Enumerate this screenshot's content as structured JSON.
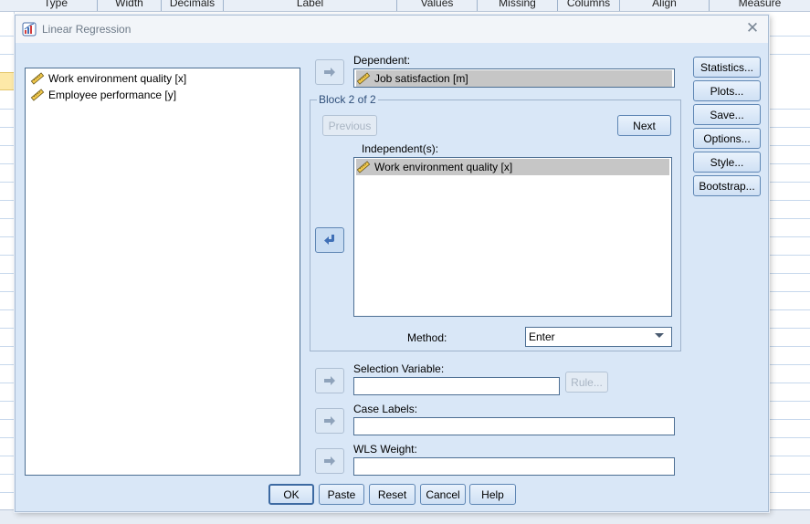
{
  "background": {
    "columns": [
      "Type",
      "Width",
      "Decimals",
      "Label",
      "Values",
      "Missing",
      "Columns",
      "Align",
      "Measure"
    ]
  },
  "dialog": {
    "title": "Linear Regression",
    "source_list": [
      {
        "label": "Work environment quality [x]",
        "icon": "scale-ruler-icon"
      },
      {
        "label": "Employee performance [y]",
        "icon": "scale-ruler-icon"
      }
    ],
    "dependent": {
      "label": "Dependent:",
      "value": "Job satisfaction [m]"
    },
    "block": {
      "title": "Block 2 of 2",
      "previous_label": "Previous",
      "next_label": "Next",
      "independents_label": "Independent(s):",
      "independents": [
        "Work environment quality [x]"
      ],
      "method_label": "Method:",
      "method_value": "Enter"
    },
    "selection_variable": {
      "label": "Selection Variable:",
      "value": "",
      "rule_label": "Rule..."
    },
    "case_labels": {
      "label": "Case Labels:",
      "value": ""
    },
    "wls_weight": {
      "label": "WLS Weight:",
      "value": ""
    },
    "side_buttons": [
      "Statistics...",
      "Plots...",
      "Save...",
      "Options...",
      "Style...",
      "Bootstrap..."
    ],
    "bottom_buttons": [
      "OK",
      "Paste",
      "Reset",
      "Cancel",
      "Help"
    ],
    "colors": {
      "dialog_bg": "#d9e7f7",
      "button_border": "#5e86b4",
      "selected_item": "#c6c6c6",
      "accent_arrow": "#3f6fb6"
    }
  }
}
